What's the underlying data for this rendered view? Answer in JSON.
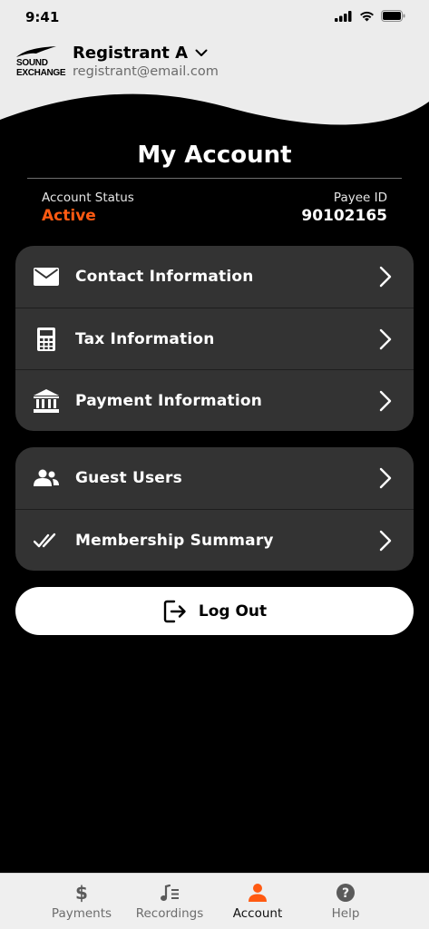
{
  "status_bar": {
    "time": "9:41"
  },
  "header": {
    "logo_text": [
      "SOUND",
      "EXCHANGE"
    ],
    "registrant_name": "Registrant A",
    "registrant_email": "registrant@email.com"
  },
  "page": {
    "title": "My Account",
    "account_status_label": "Account Status",
    "account_status_value": "Active",
    "payee_id_label": "Payee ID",
    "payee_id_value": "90102165"
  },
  "menu_group_1": [
    {
      "label": "Contact Information",
      "icon": "envelope-icon"
    },
    {
      "label": "Tax Information",
      "icon": "calculator-icon"
    },
    {
      "label": "Payment Information",
      "icon": "bank-icon"
    }
  ],
  "menu_group_2": [
    {
      "label": "Guest Users",
      "icon": "users-icon"
    },
    {
      "label": "Membership Summary",
      "icon": "double-check-icon"
    }
  ],
  "logout": {
    "label": "Log Out",
    "icon": "logout-icon"
  },
  "tabbar": {
    "tabs": [
      {
        "label": "Payments",
        "icon": "dollar-icon"
      },
      {
        "label": "Recordings",
        "icon": "music-list-icon"
      },
      {
        "label": "Account",
        "icon": "person-icon"
      },
      {
        "label": "Help",
        "icon": "question-icon"
      }
    ],
    "active": "Account"
  },
  "colors": {
    "accent": "#ff5a12",
    "background": "#000000",
    "card": "#333333",
    "header_bg": "#ececec"
  }
}
